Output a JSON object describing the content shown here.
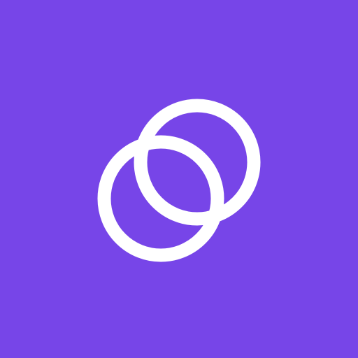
{
  "colors": {
    "background": "#7745E8",
    "ring": "#FFFFFF"
  },
  "icon": {
    "name": "interlocking-rings-icon"
  }
}
